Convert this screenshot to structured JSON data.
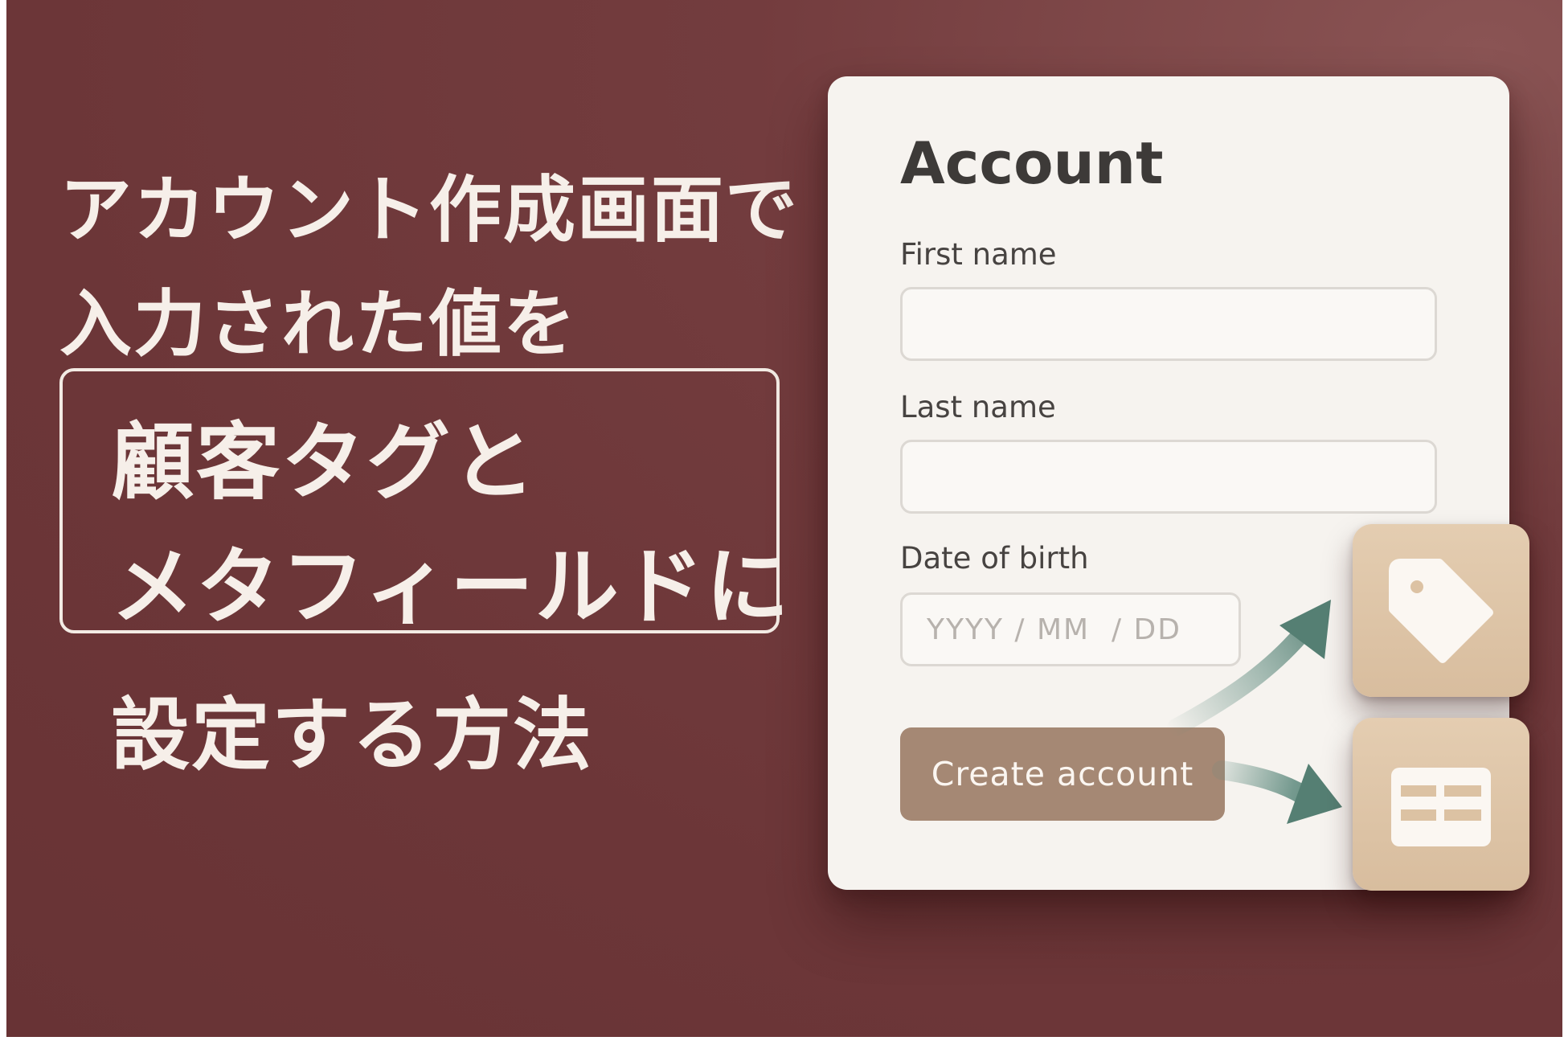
{
  "headline": {
    "line1": "アカウント作成画面で",
    "line2": "入力された値を",
    "line3": "顧客タグと",
    "line4": "メタフィールドに",
    "line5": "設定する方法"
  },
  "form": {
    "title": "Account",
    "first_name_label": "First name",
    "first_name_value": "",
    "last_name_label": "Last name",
    "last_name_value": "",
    "dob_label": "Date of birth",
    "dob_placeholder": "YYYY / MM  / DD",
    "submit_label": "Create account"
  },
  "icons": {
    "tag_tile": "tag-icon",
    "metafield_tile": "table-icon"
  },
  "colors": {
    "background": "#6c3638",
    "card": "#f6f3ef",
    "button": "#a58874",
    "tile": "#e0c6a8",
    "arrow": "#5e8a7e"
  }
}
